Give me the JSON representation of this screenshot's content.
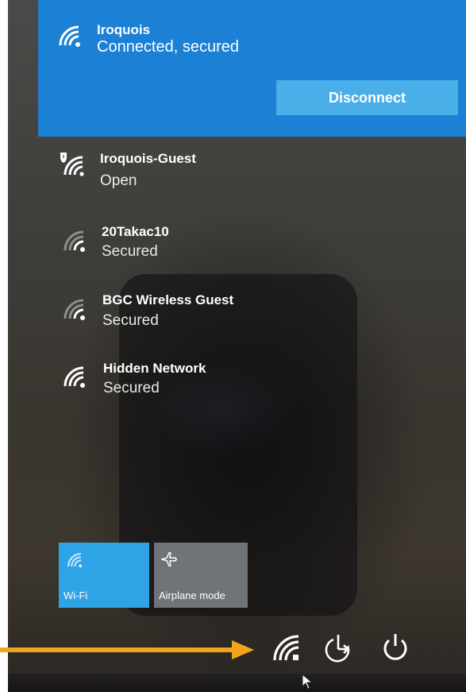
{
  "connected": {
    "name": "Iroquois",
    "status": "Connected, secured",
    "disconnect_label": "Disconnect",
    "icon": "wifi-icon"
  },
  "networks": [
    {
      "name": "Iroquois-Guest",
      "status": "Open",
      "icon": "wifi-shield-icon"
    },
    {
      "name": "20Takac10",
      "status": "Secured",
      "icon": "wifi-weak-icon"
    },
    {
      "name": "BGC Wireless Guest",
      "status": "Secured",
      "icon": "wifi-weak-icon"
    },
    {
      "name": "Hidden Network",
      "status": "Secured",
      "icon": "wifi-icon"
    }
  ],
  "quick_actions": [
    {
      "label": "Wi-Fi",
      "icon": "wifi-icon",
      "active": true
    },
    {
      "label": "Airplane mode",
      "icon": "airplane-icon",
      "active": false
    }
  ],
  "tray": [
    "network-icon",
    "power-plan-icon",
    "power-icon"
  ],
  "colors": {
    "accent": "#1c80d5",
    "button": "#4aaee8",
    "wifi_tile": "#2ea3e6",
    "airplane_tile": "#6f7479",
    "arrow": "#f2a51c"
  }
}
